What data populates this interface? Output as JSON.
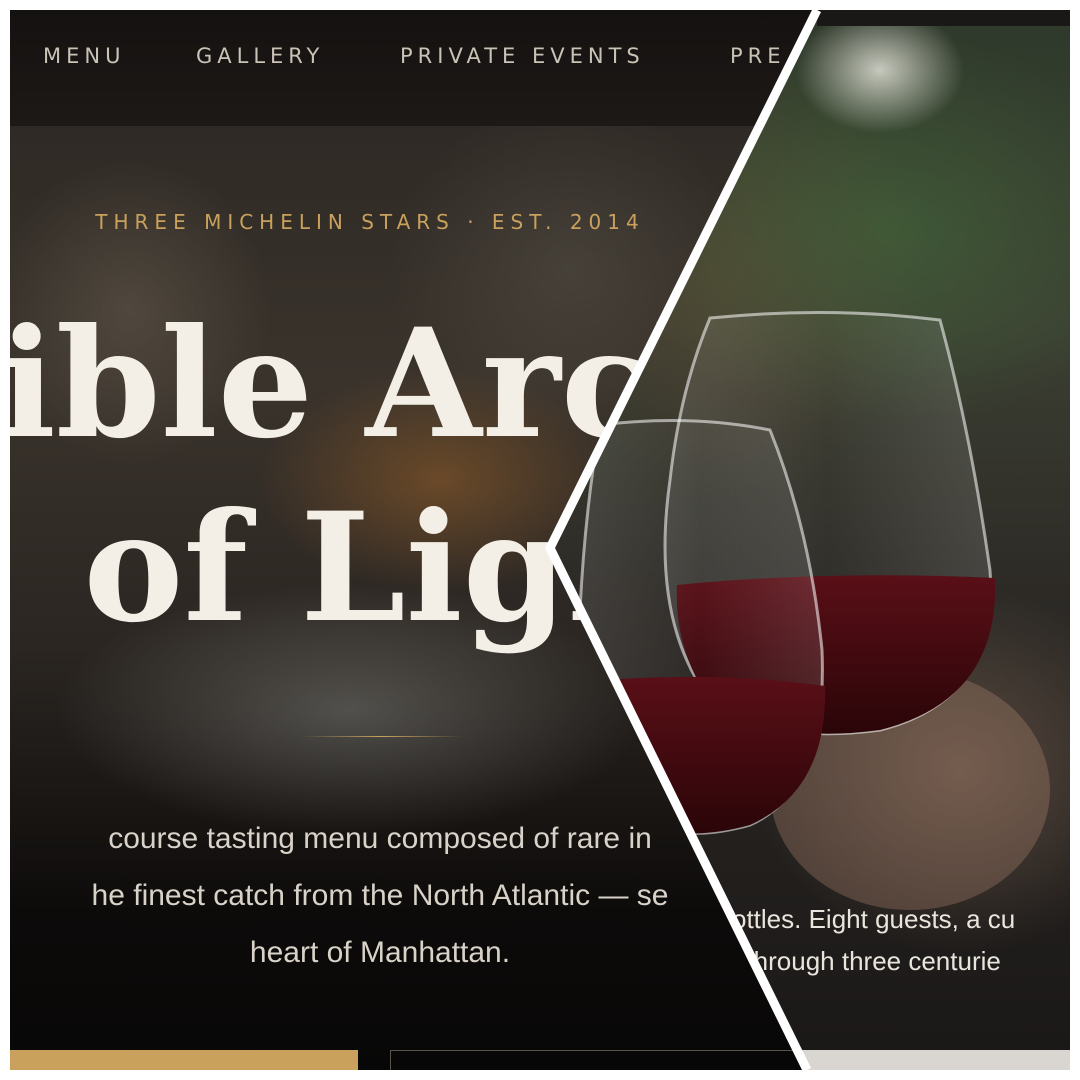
{
  "nav": {
    "items": [
      {
        "label": "MENU"
      },
      {
        "label": "GALLERY"
      },
      {
        "label": "PRIVATE EVENTS"
      },
      {
        "label": "PRE"
      }
    ]
  },
  "hero": {
    "eyebrow": "THREE MICHELIN STARS · EST. 2014",
    "headline_line1": "ible Arch",
    "headline_line2": "of Ligh",
    "lede_lines": [
      "course tasting menu composed of rare in",
      "he finest catch from the North Atlantic — se",
      "heart of Manhattan."
    ]
  },
  "wine_panel": {
    "text_lines": [
      "ottles. Eight guests, a cu",
      "t through three centurie"
    ]
  },
  "colors": {
    "accent_gold": "#c9a15c",
    "headline": "#f3efe6",
    "nav_text": "#c9c2b6",
    "body_text": "#d8d2c8",
    "seam": "#ffffff"
  }
}
